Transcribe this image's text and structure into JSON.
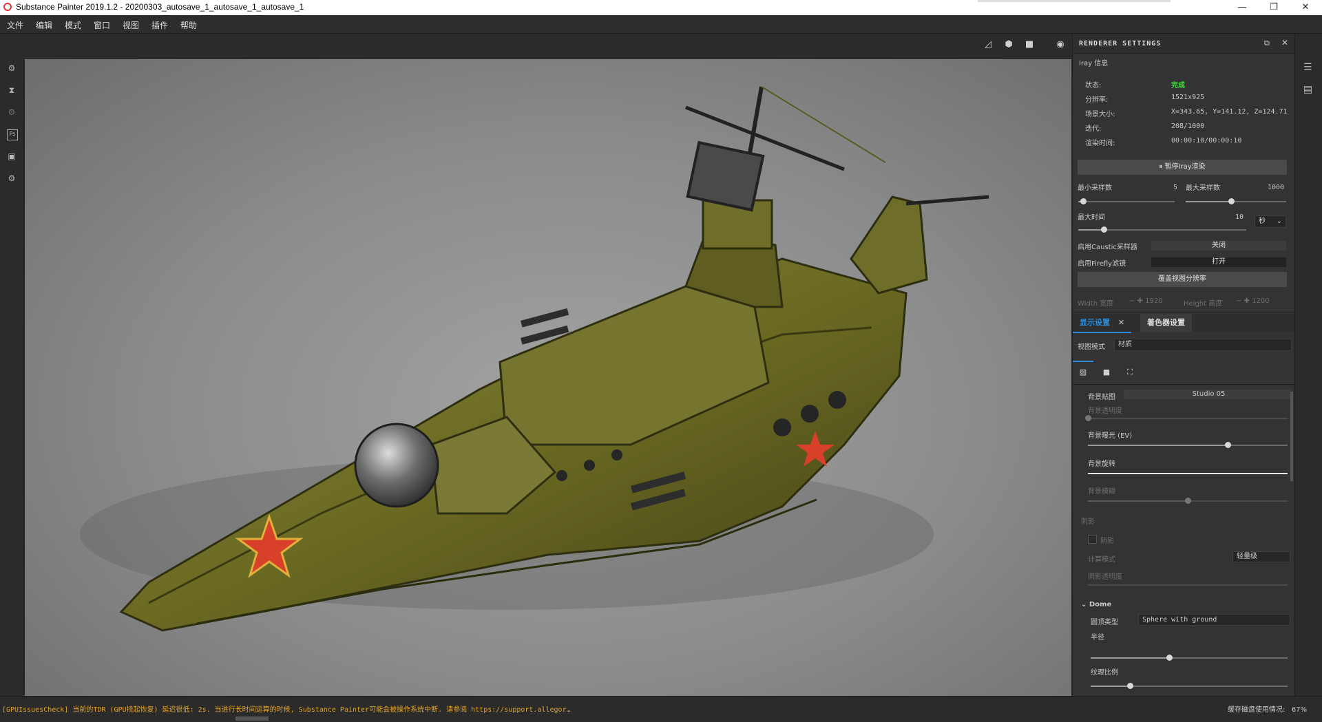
{
  "window": {
    "title": "Substance Painter 2019.1.2 - 20200303_autosave_1_autosave_1_autosave_1",
    "minimize": "—",
    "restore": "❐",
    "close": "✕"
  },
  "menu": [
    "文件",
    "编辑",
    "模式",
    "窗口",
    "视图",
    "插件",
    "帮助"
  ],
  "left_toolbar": [
    "paint-brush-icon",
    "history-icon",
    "bake-icon",
    "photoshop-icon",
    "export-icon",
    "settings-icon"
  ],
  "left_toolbar_glyphs": {
    "ps": "Ps"
  },
  "viewport_tools": [
    "2d-view-icon",
    "3d-cube-icon",
    "camera-icon",
    "screenshot-icon"
  ],
  "renderer": {
    "title": "RENDERER SETTINGS",
    "section": "Iray 信息",
    "status_label": "状态:",
    "status_value": "完成",
    "resolution_label": "分辨率:",
    "resolution_value": "1521x925",
    "scene_size_label": "场景大小:",
    "scene_size_value": "X=343.65, Y=141.12, Z=124.71",
    "iterations_label": "迭代:",
    "iterations_value": "208/1000",
    "render_time_label": "渲染时间:",
    "render_time_value": "00:00:10/00:00:10",
    "pause_button": "⏸ 暂停Iray渲染",
    "min_samples_label": "最小采样数",
    "min_samples_value": "5",
    "max_samples_label": "最大采样数",
    "max_samples_value": "1000",
    "max_time_label": "最大时间",
    "max_time_value": "10",
    "time_unit": "秒",
    "caustic_label": "启用Caustic采样器",
    "caustic_value": "关闭",
    "firefly_label": "启用Firefly滤镜",
    "firefly_value": "打开",
    "override_button": "覆盖视图分辨率",
    "width_label": "Width 宽度",
    "width_value": "1920",
    "height_label": "Height 高度",
    "height_value": "1200"
  },
  "display": {
    "tab_display": "显示设置",
    "tab_shader": "着色器设置",
    "view_mode_label": "视图模式",
    "view_mode_value": "材质",
    "env_map_label": "背景贴图",
    "env_map_value": "Studio 05",
    "bg_opacity_label": "背景透明度",
    "bg_exposure_label": "背景曝光 (EV)",
    "bg_rotation_label": "背景旋转",
    "bg_blur_label": "背景模糊",
    "shadows_section": "阴影",
    "shadows_checkbox": "阴影",
    "compute_mode_label": "计算模式",
    "compute_mode_value": "轻量级",
    "shadow_opacity_label": "阴影透明度",
    "dome_section": "Dome",
    "dome_type_label": "圆顶类型",
    "dome_type_value": "Sphere with ground",
    "radius_label": "半径",
    "texture_scale_label": "纹理比例",
    "sliders": {
      "bg_opacity": 0.0,
      "bg_exposure": 0.7,
      "bg_rotation": 1.0,
      "bg_blur": 0.5,
      "radius": 0.4,
      "texture_scale": 0.2,
      "min_samples": 0.05,
      "max_samples": 0.45,
      "max_time": 0.15
    }
  },
  "status": {
    "warning": "[GPUIssuesCheck] 当前的TDR (GPU挂起恢复) 延迟很低: 2s. 当进行长时间运算的时候, Substance Painter可能会被操作系统中断. 请参阅 https://support.allegor…",
    "cache_label": "缓存磁盘使用情况:",
    "cache_value": "67%"
  },
  "colors": {
    "accent": "#2d8ad6",
    "status_ok": "#3ddc3d",
    "warning": "#e3a326",
    "hull": "#6b6a23"
  }
}
